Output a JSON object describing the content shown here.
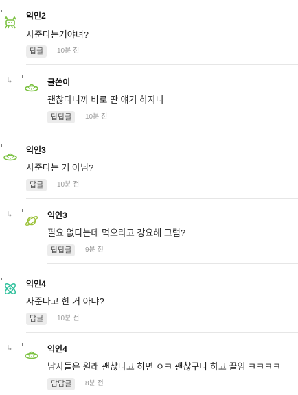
{
  "comments": [
    {
      "kind": "top",
      "author": "익인2",
      "author_is_op": false,
      "text": "사준다는거야녀?",
      "reply_label": "답글",
      "time": "10분 전",
      "avatar_icon": "green-crab-icon"
    },
    {
      "kind": "reply",
      "author": "글쓴이",
      "author_is_op": true,
      "text": "괜찮다니까 바로 딴 얘기 하자나",
      "reply_label": "답답글",
      "time": "10분 전",
      "avatar_icon": "green-ufo-icon"
    },
    {
      "kind": "top",
      "author": "익인3",
      "author_is_op": false,
      "text": "사준다는 거 아님?",
      "reply_label": "답글",
      "time": "10분 전",
      "avatar_icon": "green-ufo-icon"
    },
    {
      "kind": "reply",
      "author": "익인3",
      "author_is_op": false,
      "text": "필요 없다는데 먹으라고 강요해 그럼?",
      "reply_label": "답답글",
      "time": "9분 전",
      "avatar_icon": "green-planet-icon"
    },
    {
      "kind": "top",
      "author": "익인4",
      "author_is_op": false,
      "text": "사준다고 한 거 아냐?",
      "reply_label": "답글",
      "time": "10분 전",
      "avatar_icon": "teal-atom-icon"
    },
    {
      "kind": "reply",
      "author": "익인4",
      "author_is_op": false,
      "text": "남자들은 원래 괜찮다고 하면 ㅇㅋ 괜찮구나 하고 끝임 ㅋㅋㅋㅋ",
      "reply_label": "답답글",
      "time": "8분 전",
      "avatar_icon": "green-ufo-icon"
    }
  ],
  "colors": {
    "avatar_green": "#7cc242",
    "avatar_teal": "#2bbf9a",
    "avatar_planet": "#9cc23a"
  }
}
